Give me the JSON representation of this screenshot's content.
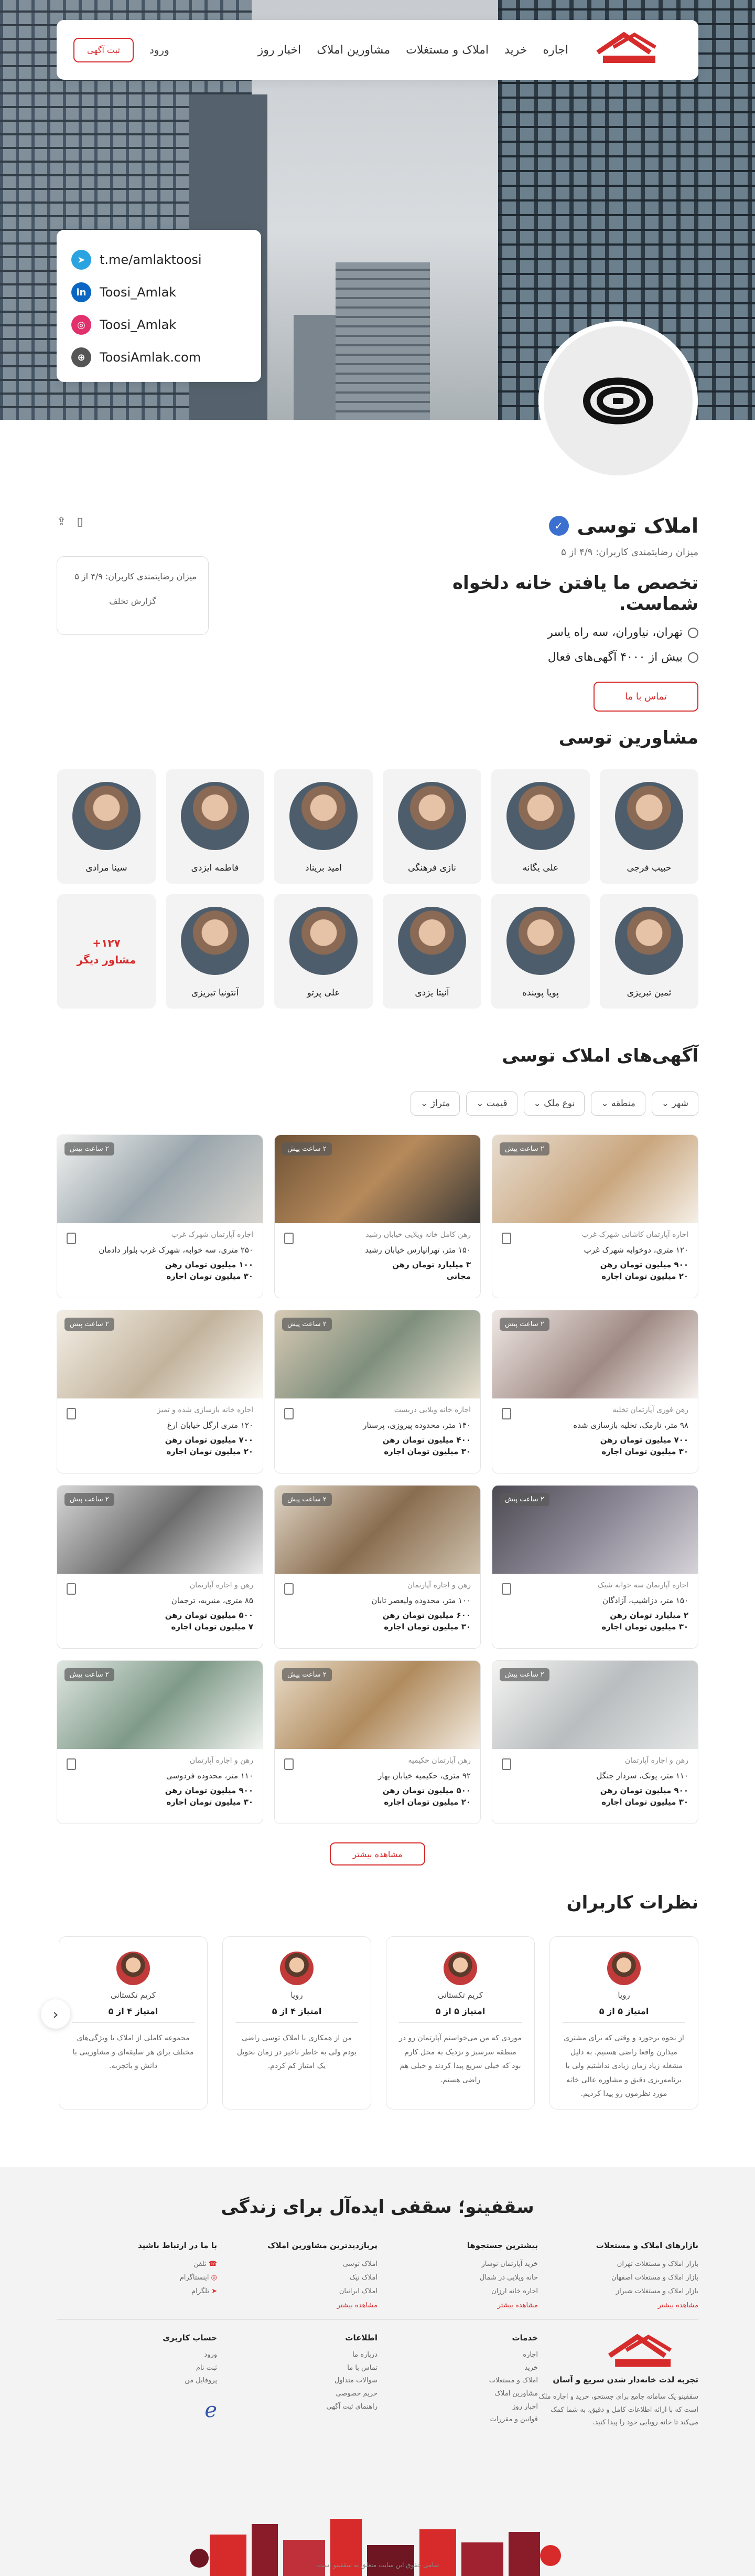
{
  "nav": {
    "links": [
      "اجاره",
      "خرید",
      "املاک و مستغلات",
      "مشاورین املاک",
      "اخبار روز"
    ],
    "login": "ورود",
    "ad_button": "ثبت آگهی"
  },
  "social": {
    "telegram": "t.me/amlaktoosi",
    "linkedin": "Toosi_Amlak",
    "instagram": "Toosi_Amlak",
    "web": "ToosiAmlak.com"
  },
  "profile": {
    "name": "املاک توسی",
    "rating": "میزان رضایتمندی کاربران: ۴/۹ از ۵",
    "headline": "تخصص ما یافتن خانه دلخواه شماست.",
    "location": "تهران، نیاوران، سه راه یاسر",
    "active_ads": "بیش از ۴۰۰۰ آگهی‌های فعال",
    "contact": "تماس با ما",
    "box_rating": "میزان رضایتمندی کاربران: ۴/۹ از ۵",
    "report": "گزارش تخلف"
  },
  "consultants": {
    "title": "مشاورین توسی",
    "items": [
      "حبیب فرجی",
      "علی یگانه",
      "نازی فرهنگی",
      "امید بریناد",
      "فاطمه ایزدی",
      "سینا مرادی",
      "ثمین تبریزی",
      "پویا پوینده",
      "آنیتا یزدی",
      "علی پرتو",
      "آنتونیا تبریزی"
    ],
    "more": "۱۲۷+\nمشاور دیگر"
  },
  "listings": {
    "title": "آگهی‌های املاک توسی",
    "filters": [
      "شهر",
      "منطقه",
      "نوع ملک",
      "قیمت",
      "متراژ"
    ],
    "items": [
      {
        "tag": "۲ ساعت پیش",
        "t1": "اجاره آپارتمان کاشانی شهرک غرب",
        "t2": "۱۲۰ متری، دوخوابه شهرک غرب",
        "t3": "۹۰۰ میلیون تومان رهن",
        "t4": "۲۰ میلیون تومان اجاره"
      },
      {
        "tag": "۲ ساعت پیش",
        "t1": "رهن کامل خانه ویلایی خیابان رشید",
        "t2": "۱۵۰ متر، تهرانپارس خیابان رشید",
        "t3": "۳ میلیارد تومان رهن",
        "t4": "مجانی"
      },
      {
        "tag": "۲ ساعت پیش",
        "t1": "اجاره آپارتمان شهرک غرب",
        "t2": "۲۵۰ متری، سه خوابه، شهرک غرب بلوار دادمان",
        "t3": "۱۰۰ میلیون تومان رهن",
        "t4": "۳۰ میلیون تومان اجاره"
      },
      {
        "tag": "۲ ساعت پیش",
        "t1": "رهن فوری آپارتمان تخلیه",
        "t2": "۹۸ متر، نارمک، تخلیه بازسازی شده",
        "t3": "۷۰۰ میلیون تومان رهن",
        "t4": "۳۰ میلیون تومان اجاره"
      },
      {
        "tag": "۲ ساعت پیش",
        "t1": "اجاره خانه ویلایی دربست",
        "t2": "۱۴۰ متر، محدوده پیروزی، پرستار",
        "t3": "۴۰۰ میلیون تومان رهن",
        "t4": "۳۰ میلیون تومان اجاره"
      },
      {
        "tag": "۲ ساعت پیش",
        "t1": "اجاره خانه بازسازی شده و تمیز",
        "t2": "۱۲۰ متری ارگل خیابان ارغ",
        "t3": "۷۰۰ میلیون تومان رهن",
        "t4": "۲۰ میلیون تومان اجاره"
      },
      {
        "tag": "۲ ساعت پیش",
        "t1": "اجاره آپارتمان سه خوابه شیک",
        "t2": "۱۵۰ متر، دزاشیب، آزادگان",
        "t3": "۲ میلیارد تومان رهن",
        "t4": "۳۰ میلیون تومان اجاره"
      },
      {
        "tag": "۲ ساعت پیش",
        "t1": "رهن و اجاره آپارتمان",
        "t2": "۱۰۰ متر، محدوده ولیعصر تابان",
        "t3": "۶۰۰ میلیون تومان رهن",
        "t4": "۳۰ میلیون تومان اجاره"
      },
      {
        "tag": "۲ ساعت پیش",
        "t1": "رهن و اجاره آپارتمان",
        "t2": "۸۵ متری، منیریه، ترجمان",
        "t3": "۵۰۰ میلیون تومان رهن",
        "t4": "۷ میلیون تومان اجاره"
      },
      {
        "tag": "۲ ساعت پیش",
        "t1": "رهن و اجاره آپارتمان",
        "t2": "۱۱۰ متر، پونک، سردار جنگل",
        "t3": "۹۰۰ میلیون تومان رهن",
        "t4": "۳۰ میلیون تومان اجاره"
      },
      {
        "tag": "۲ ساعت پیش",
        "t1": "رهن آپارتمان حکیمیه",
        "t2": "۹۲ متری، حکیمیه خیابان بهار",
        "t3": "۵۰۰ میلیون تومان رهن",
        "t4": "۲۰ میلیون تومان اجاره"
      },
      {
        "tag": "۲ ساعت پیش",
        "t1": "رهن و اجاره آپارتمان",
        "t2": "۱۱۰ متر، محدوده فردوسی",
        "t3": "۹۰۰ میلیون تومان رهن",
        "t4": "۳۰ میلیون تومان اجاره"
      }
    ],
    "more": "مشاهده بیشتر"
  },
  "reviews": {
    "title": "نظرات کاربران",
    "items": [
      {
        "name": "رویا",
        "score": "امتیاز ۵ از ۵",
        "text": "از نحوه برخورد و وقتی که برای مشتری میذارن واقعا راضی هستیم. به دلیل مشغله زیاد زمان زیادی نداشتیم ولی با برنامه‌ریزی دقیق و مشاوره عالی خانه مورد نظرمون رو پیدا کردیم."
      },
      {
        "name": "کریم تکستانی",
        "score": "امتیاز ۵ از ۵",
        "text": "موردی که من می‌خواستم آپارتمان رو در منطقه سرسبز و نزدیک به محل کارم بود که خیلی سریع پیدا کردند و خیلی هم راضی هستم."
      },
      {
        "name": "رویا",
        "score": "امتیاز ۴ از ۵",
        "text": "من از همکاری با املاک توسی راضی بودم ولی به خاطر تاخیر در زمان تحویل یک امتیاز کم کردم."
      },
      {
        "name": "کریم تکستانی",
        "score": "امتیاز ۴ از ۵",
        "text": "مجموعه کاملی از املاک با ویژگی‌های مختلف برای هر سلیقه‌ای و مشاورینی با دانش و باتجربه."
      }
    ]
  },
  "footer": {
    "title": "سقفینو؛ سقفی ایده‌آل برای زندگی",
    "col1": {
      "h": "بازارهای املاک و مستغلات",
      "items": [
        "بازار املاک و مستغلات تهران",
        "بازار املاک و مستغلات اصفهان",
        "بازار املاک و مستغلات شیراز"
      ],
      "more": "مشاهده بیشتر"
    },
    "col2": {
      "h": "بیشترین جستجوها",
      "items": [
        "خرید آپارتمان نوساز",
        "خانه ویلایی در شمال",
        "اجاره خانه ارزان"
      ],
      "more": "مشاهده بیشتر"
    },
    "col3": {
      "h": "پربازدیدترین مشاورین املاک",
      "items": [
        "املاک توسی",
        "املاک نیک",
        "املاک ایرانیان"
      ],
      "more": "مشاهده بیشتر"
    },
    "col4": {
      "h": "با ما در ارتباط باشید",
      "items": [
        "تلفن",
        "اینستاگرام",
        "تلگرام"
      ]
    },
    "about_h": "تجربه لذت خانه‌دار شدن سریع و آسان",
    "about": "سقفینو یک سامانه جامع برای جستجو، خرید و اجاره ملک است که با ارائه اطلاعات کامل و دقیق، به شما کمک می‌کند تا خانه رویایی خود را پیدا کنید.",
    "services_h": "خدمات",
    "services": [
      "اجاره",
      "خرید",
      "املاک و مستغلات",
      "مشاورین املاک",
      "اخبار روز",
      "قوانین و مقررات"
    ],
    "info_h": "اطلاعات",
    "info": [
      "درباره ما",
      "تماس با ما",
      "سوالات متداول",
      "حریم خصوصی",
      "راهنمای ثبت آگهی"
    ],
    "account_h": "حساب کاربری",
    "account": [
      "ورود",
      "ثبت نام",
      "پروفایل من"
    ],
    "copy": "تمامی حقوق این سایت متعلق به سقفینو است."
  }
}
